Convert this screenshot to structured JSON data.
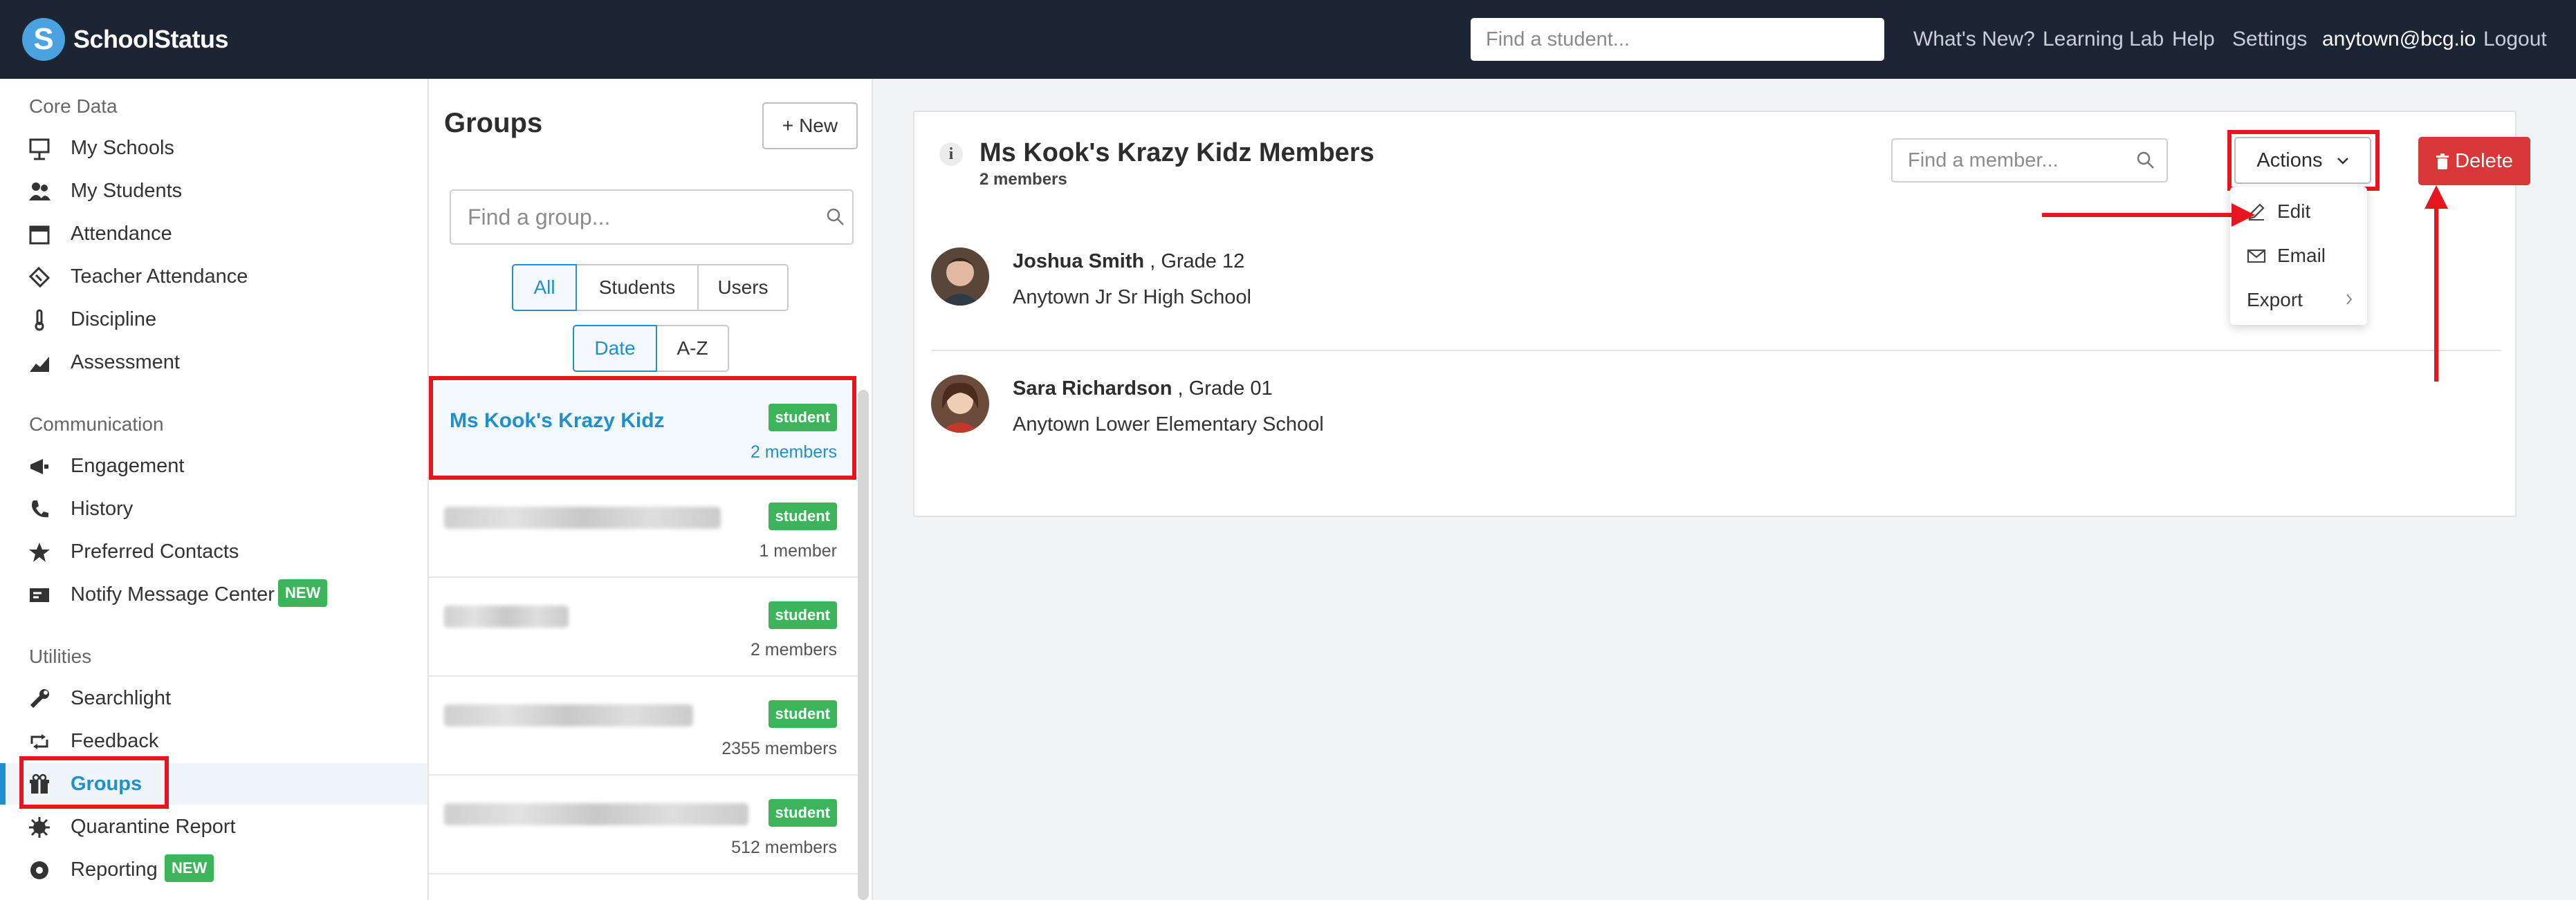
{
  "app": {
    "brand": "SchoolStatus",
    "logo_letter": "S"
  },
  "topnav": {
    "student_search_placeholder": "Find a student...",
    "links": [
      "What's New?",
      "Learning Lab",
      "Help",
      "Settings"
    ],
    "user": "anytown@bcg.io",
    "logout": "Logout"
  },
  "sidebar": {
    "sections": {
      "core": {
        "title": "Core Data",
        "items": [
          {
            "label": "My Schools",
            "icon": "easel-icon"
          },
          {
            "label": "My Students",
            "icon": "students-icon"
          },
          {
            "label": "Attendance",
            "icon": "calendar-icon"
          },
          {
            "label": "Teacher Attendance",
            "icon": "ticket-icon"
          },
          {
            "label": "Discipline",
            "icon": "thermometer-icon"
          },
          {
            "label": "Assessment",
            "icon": "chart-icon"
          }
        ]
      },
      "communication": {
        "title": "Communication",
        "items": [
          {
            "label": "Engagement",
            "icon": "megaphone-icon"
          },
          {
            "label": "History",
            "icon": "phone-icon"
          },
          {
            "label": "Preferred Contacts",
            "icon": "star-icon"
          },
          {
            "label": "Notify Message Center",
            "icon": "message-icon",
            "badge": "NEW"
          }
        ]
      },
      "utilities": {
        "title": "Utilities",
        "items": [
          {
            "label": "Searchlight",
            "icon": "wrench-icon"
          },
          {
            "label": "Feedback",
            "icon": "retweet-icon"
          },
          {
            "label": "Groups",
            "icon": "gift-icon",
            "active": true
          },
          {
            "label": "Quarantine Report",
            "icon": "virus-icon"
          },
          {
            "label": "Reporting",
            "icon": "record-icon",
            "badge": "NEW"
          }
        ]
      }
    }
  },
  "groups": {
    "title": "Groups",
    "new_button": "New",
    "search_placeholder": "Find a group...",
    "filters": [
      "All",
      "Students",
      "Users"
    ],
    "sort": [
      "Date",
      "A-Z"
    ],
    "list": [
      {
        "name": "Ms Kook's Krazy Kidz",
        "type": "student",
        "members": "2 members",
        "selected": true
      },
      {
        "name": "",
        "type": "student",
        "members": "1 member",
        "blurred": true
      },
      {
        "name": "",
        "type": "student",
        "members": "2 members",
        "blurred": true
      },
      {
        "name": "",
        "type": "student",
        "members": "2355 members",
        "blurred": true
      },
      {
        "name": "",
        "type": "student",
        "members": "512 members",
        "blurred": true
      }
    ]
  },
  "detail": {
    "info_icon": "i",
    "title": "Ms Kook's Krazy Kidz Members",
    "subtitle": "2 members",
    "member_search_placeholder": "Find a member...",
    "actions_label": "Actions",
    "delete_label": "Delete",
    "actions_menu": [
      "Edit",
      "Email",
      "Export"
    ],
    "members": [
      {
        "name": "Joshua Smith",
        "grade": ", Grade 12",
        "school": "Anytown Jr Sr High School"
      },
      {
        "name": "Sara Richardson",
        "grade": ", Grade 01",
        "school": "Anytown Lower Elementary School"
      }
    ]
  },
  "colors": {
    "nav_bg": "#1b2533",
    "accent": "#1f8fce",
    "badge_green": "#3cb55a",
    "delete_red": "#d9383a",
    "annotation_red": "#e8141e"
  }
}
